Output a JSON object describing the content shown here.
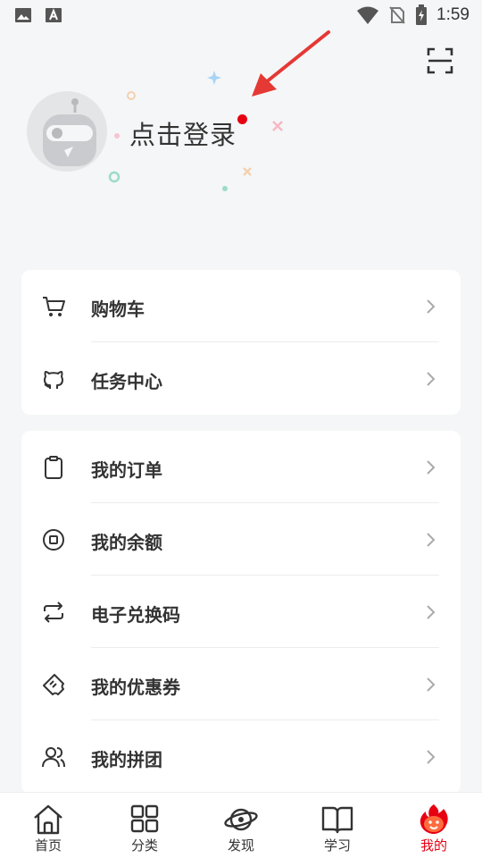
{
  "status_bar": {
    "time": "1:59",
    "icons": [
      "image-icon",
      "text-a-icon",
      "wifi-icon",
      "no-sim-icon",
      "battery-icon"
    ]
  },
  "header": {
    "login_text": "点击登录",
    "notification_dot_color": "#e60012",
    "arrow_color": "#e53935",
    "scan_icon": "scan-icon"
  },
  "menu_groups": [
    {
      "items": [
        {
          "label": "购物车",
          "icon": "cart-icon"
        },
        {
          "label": "任务中心",
          "icon": "github-cat-icon"
        }
      ]
    },
    {
      "items": [
        {
          "label": "我的订单",
          "icon": "clipboard-icon"
        },
        {
          "label": "我的余额",
          "icon": "coin-icon"
        },
        {
          "label": "电子兑换码",
          "icon": "exchange-icon"
        },
        {
          "label": "我的优惠券",
          "icon": "coupon-icon"
        },
        {
          "label": "我的拼团",
          "icon": "group-users-icon"
        }
      ]
    }
  ],
  "tabbar": {
    "active_color": "#e60012",
    "tabs": [
      {
        "label": "首页",
        "icon": "home-icon",
        "active": false
      },
      {
        "label": "分类",
        "icon": "grid-icon",
        "active": false
      },
      {
        "label": "发现",
        "icon": "planet-icon",
        "active": false
      },
      {
        "label": "学习",
        "icon": "book-icon",
        "active": false
      },
      {
        "label": "我的",
        "icon": "flame-mascot-icon",
        "active": true
      }
    ]
  }
}
